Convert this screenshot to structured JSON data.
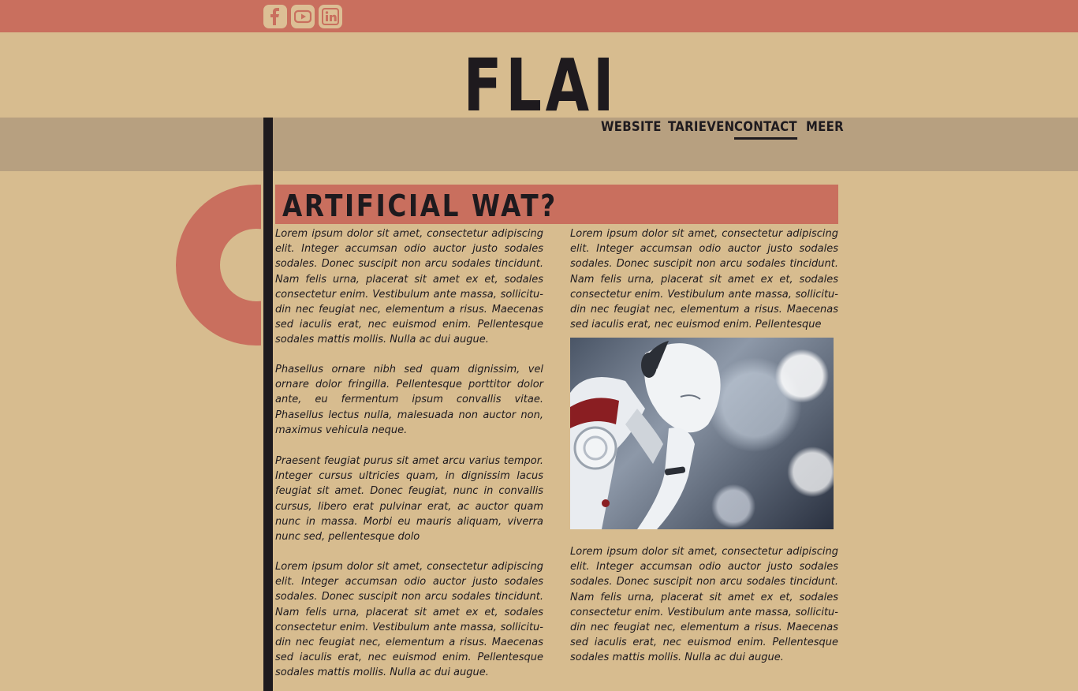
{
  "social": [
    {
      "name": "facebook",
      "icon": "facebook-icon"
    },
    {
      "name": "youtube",
      "icon": "youtube-icon"
    },
    {
      "name": "linkedin",
      "icon": "linkedin-icon"
    }
  ],
  "site": {
    "logo": "FLAI"
  },
  "nav": [
    {
      "label": "WEBSITE",
      "active": false
    },
    {
      "label": "TARIEVEN",
      "active": false
    },
    {
      "label": "CONTACT",
      "active": true
    },
    {
      "label": "MEER",
      "active": false
    }
  ],
  "article": {
    "title": "ARTIFICIAL WAT?",
    "left_paragraphs": [
      "Lorem ipsum dolor sit amet, consectetur adipiscing elit. Integer accumsan odio auctor justo sodales sodales. Donec suscipit non arcu sodales tincidunt. Nam felis urna, placerat sit amet ex et, sodales consectetur enim. Vestibulum ante massa, sollicitu-din nec feugiat nec, elementum a risus. Maecenas sed iaculis erat, nec euismod enim. Pellentesque sodales mattis mollis. Nulla ac dui augue.",
      "Phasellus ornare nibh sed quam dignissim, vel ornare dolor fringilla. Pellentesque porttitor dolor ante, eu fermentum ipsum convallis vitae. Phasellus lectus nulla, malesuada non auctor non, maximus vehicula neque.",
      " Praesent feugiat purus sit amet arcu varius tempor. Integer cursus ultricies quam, in dignissim lacus feugiat sit amet. Donec feugiat, nunc in convallis cursus, libero erat pulvinar erat, ac auctor quam nunc in massa. Morbi eu mauris aliquam, viverra nunc sed, pellentesque dolo",
      "Lorem ipsum dolor sit amet, consectetur adipiscing elit. Integer accumsan odio auctor justo sodales sodales. Donec suscipit non arcu sodales tincidunt. Nam felis urna, placerat sit amet ex et, sodales consectetur enim. Vestibulum ante massa, sollicitu-din nec feugiat nec, elementum a risus. Maecenas sed iaculis erat, nec euismod enim. Pellentesque sodales mattis mollis. Nulla ac dui augue."
    ],
    "right_paragraphs": [
      "Lorem ipsum dolor sit amet, consectetur adipiscing elit. Integer accumsan odio auctor justo sodales sodales. Donec suscipit non arcu sodales tincidunt. Nam felis urna, placerat sit amet ex et, sodales consectetur enim. Vestibulum ante massa, sollicitu-din nec feugiat nec, elementum a risus. Maecenas sed iaculis erat, nec euismod enim. Pellentesque",
      "Lorem ipsum dolor sit amet, consectetur adipiscing elit. Integer accumsan odio auctor justo sodales sodales. Donec suscipit non arcu sodales tincidunt. Nam felis urna, placerat sit amet ex et, sodales consectetur enim. Vestibulum ante massa, sollicitu-din nec feugiat nec, elementum a risus. Maecenas sed iaculis erat, nec euismod enim. Pellentesque sodales mattis mollis. Nulla ac dui augue."
    ],
    "image": {
      "icon": "robot-thinking-image"
    }
  },
  "colors": {
    "background": "#d7bc8f",
    "accent": "#c96f5e",
    "nav_band": "#b7a080",
    "text": "#1e1a1e"
  }
}
